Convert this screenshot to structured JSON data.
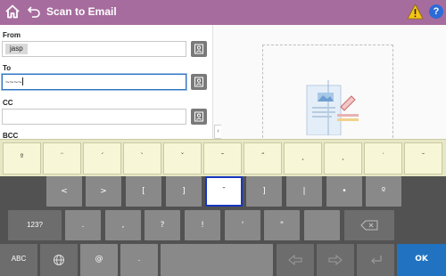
{
  "app": {
    "title": "Scan to Email"
  },
  "form": {
    "from_label": "From",
    "from_value": "jasp",
    "to_label": "To",
    "to_value": "~~~~",
    "cc_label": "CC",
    "cc_value": "",
    "bcc_label": "BCC"
  },
  "candidates": [
    "º",
    "¨",
    "´",
    "`",
    "ˇ",
    "˜",
    "˝",
    "¸",
    "˛",
    "˙",
    "˘"
  ],
  "keyboard": {
    "row1": [
      "<",
      ">",
      "[",
      "]",
      "¯",
      "]",
      "|",
      "•",
      "º"
    ],
    "row2": [
      ".",
      ",",
      "?",
      "!",
      "'",
      "\""
    ],
    "key_123": "123?",
    "key_abc": "ABC",
    "key_at": "@",
    "key_dot": ".",
    "key_ok": "OK"
  },
  "colors": {
    "titlebar": "#a76c9e",
    "candidate_bar": "#e7e7c4",
    "keyboard_bg": "#525252",
    "selected_border": "#1736c2",
    "ok_key": "#2173c2"
  }
}
